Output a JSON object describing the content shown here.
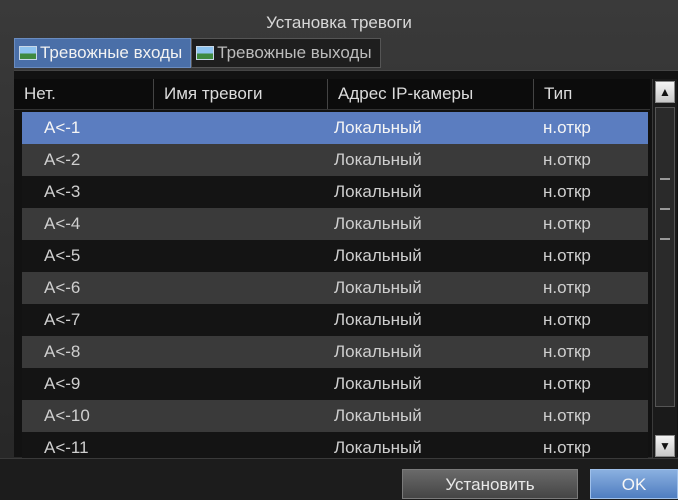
{
  "window": {
    "title": "Установка тревоги"
  },
  "tabs": [
    {
      "label": "Тревожные входы",
      "icon": "picture-icon",
      "active": true
    },
    {
      "label": "Тревожные выходы",
      "icon": "picture-icon",
      "active": false
    }
  ],
  "table": {
    "columns": [
      "Нет.",
      "Имя тревоги",
      "Адрес IP-камеры",
      "Тип"
    ],
    "rows": [
      {
        "no": "A<-1",
        "name": "",
        "ip": "Локальный",
        "type": "н.откр",
        "selected": true
      },
      {
        "no": "A<-2",
        "name": "",
        "ip": "Локальный",
        "type": "н.откр"
      },
      {
        "no": "A<-3",
        "name": "",
        "ip": "Локальный",
        "type": "н.откр"
      },
      {
        "no": "A<-4",
        "name": "",
        "ip": "Локальный",
        "type": "н.откр"
      },
      {
        "no": "A<-5",
        "name": "",
        "ip": "Локальный",
        "type": "н.откр"
      },
      {
        "no": "A<-6",
        "name": "",
        "ip": "Локальный",
        "type": "н.откр"
      },
      {
        "no": "A<-7",
        "name": "",
        "ip": "Локальный",
        "type": "н.откр"
      },
      {
        "no": "A<-8",
        "name": "",
        "ip": "Локальный",
        "type": "н.откр"
      },
      {
        "no": "A<-9",
        "name": "",
        "ip": "Локальный",
        "type": "н.откр"
      },
      {
        "no": "A<-10",
        "name": "",
        "ip": "Локальный",
        "type": "н.откр"
      },
      {
        "no": "A<-11",
        "name": "",
        "ip": "Локальный",
        "type": "н.откр"
      }
    ]
  },
  "scrollbar": {
    "up_icon": "chevron-up-icon",
    "down_icon": "chevron-down-icon"
  },
  "buttons": {
    "set": "Установить",
    "ok": "OK"
  },
  "colors": {
    "selected_row": "#5b7dc0",
    "active_tab": "#4a6fa8",
    "ok_button": "#5f8cd0"
  }
}
